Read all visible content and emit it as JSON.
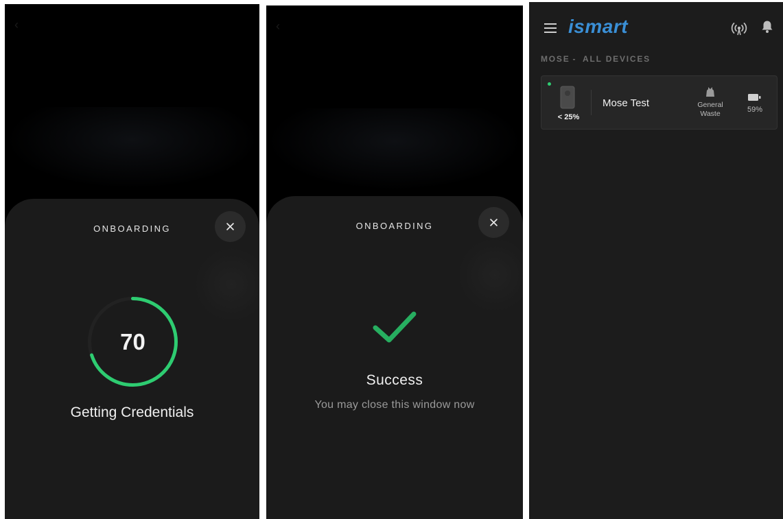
{
  "onboarding_progress": {
    "sheet_title": "ONBOARDING",
    "progress_value": "70",
    "progress_fraction": 0.7,
    "status": "Getting Credentials",
    "close_icon": "close-icon",
    "accent": "#2ecc71"
  },
  "onboarding_success": {
    "sheet_title": "ONBOARDING",
    "title": "Success",
    "message": "You may close this window now",
    "check_icon": "check-icon",
    "accent": "#27ae60"
  },
  "devices_screen": {
    "logo": "ismart",
    "logo_color": "#3a8fd6",
    "section": {
      "site": "MOSE",
      "separator": "-",
      "filter": "ALL DEVICES"
    },
    "device": {
      "name": "Mose Test",
      "fill_level": "< 25%",
      "waste_type_line1": "General",
      "waste_type_line2": "Waste",
      "battery": "59%",
      "status_color": "#2ecc71"
    }
  }
}
